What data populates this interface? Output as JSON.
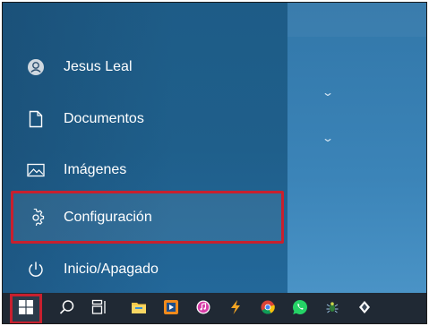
{
  "start_menu": {
    "items": [
      {
        "label": "Jesus Leal",
        "icon": "user-avatar-icon"
      },
      {
        "label": "Documentos",
        "icon": "document-icon"
      },
      {
        "label": "Imágenes",
        "icon": "pictures-icon"
      },
      {
        "label": "Configuración",
        "icon": "gear-icon"
      },
      {
        "label": "Inicio/Apagado",
        "icon": "power-icon"
      }
    ],
    "highlight_color": "#c8202e",
    "selected_item": "Configuración"
  },
  "tiles": {
    "group_chevrons": [
      "chevron-down-icon",
      "chevron-down-icon"
    ]
  },
  "taskbar": {
    "buttons": [
      {
        "name": "start-button",
        "icon": "windows-logo-icon"
      },
      {
        "name": "search-button",
        "icon": "search-icon"
      },
      {
        "name": "task-view-button",
        "icon": "task-view-icon"
      },
      {
        "name": "file-explorer-button",
        "icon": "folder-icon"
      },
      {
        "name": "media-player-button",
        "icon": "media-player-icon"
      },
      {
        "name": "itunes-button",
        "icon": "itunes-icon"
      },
      {
        "name": "app-button",
        "icon": "bolt-app-icon"
      },
      {
        "name": "chrome-button",
        "icon": "chrome-icon"
      },
      {
        "name": "whatsapp-button",
        "icon": "whatsapp-icon"
      },
      {
        "name": "app-button-2",
        "icon": "bug-app-icon"
      },
      {
        "name": "app-button-3",
        "icon": "diamond-app-icon"
      }
    ]
  }
}
